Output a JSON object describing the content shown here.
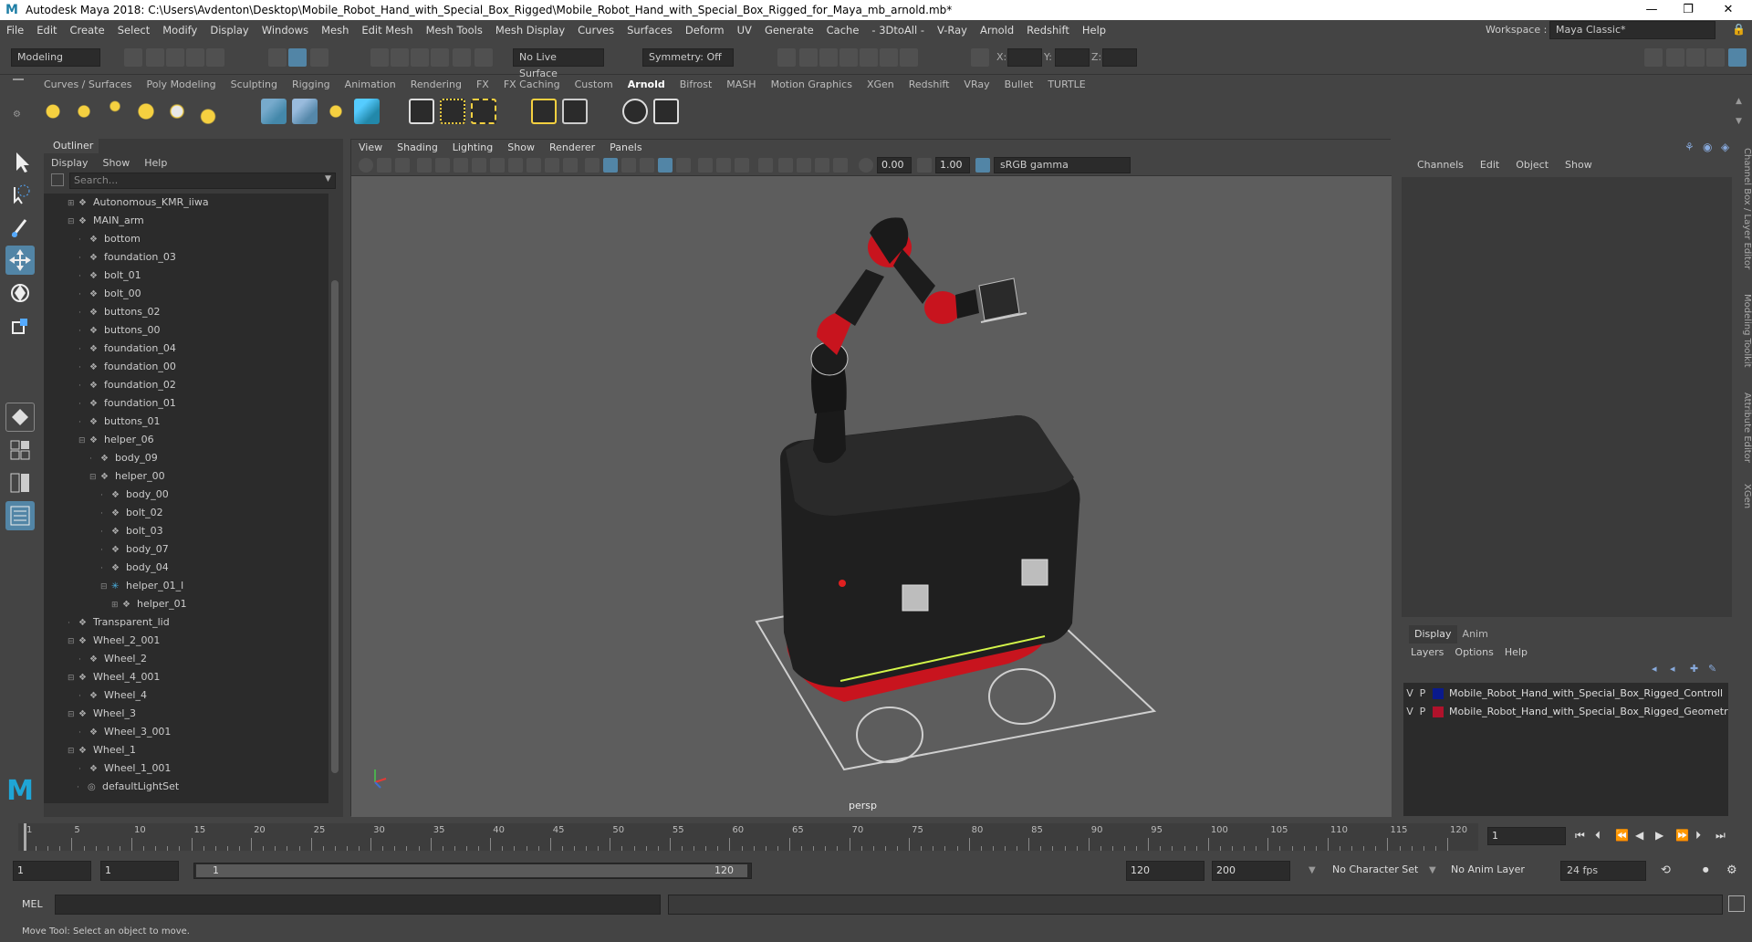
{
  "titlebar": {
    "title": "Autodesk Maya 2018: C:\\Users\\Avdenton\\Desktop\\Mobile_Robot_Hand_with_Special_Box_Rigged\\Mobile_Robot_Hand_with_Special_Box_Rigged_for_Maya_mb_arnold.mb*",
    "minimize": "—",
    "maximize": "❐",
    "close": "✕"
  },
  "menubar": [
    "File",
    "Edit",
    "Create",
    "Select",
    "Modify",
    "Display",
    "Windows",
    "Mesh",
    "Edit Mesh",
    "Mesh Tools",
    "Mesh Display",
    "Curves",
    "Surfaces",
    "Deform",
    "UV",
    "Generate",
    "Cache",
    "- 3DtoAll -",
    "V-Ray",
    "Arnold",
    "Redshift",
    "Help"
  ],
  "workspace": {
    "label": "Workspace :",
    "value": "Maya Classic*"
  },
  "statusline": {
    "mode": "Modeling",
    "live_surface": "No Live Surface",
    "symmetry": "Symmetry: Off",
    "x_label": "X:",
    "y_label": "Y:",
    "z_label": "Z:"
  },
  "shelf_tabs": [
    "Curves / Surfaces",
    "Poly Modeling",
    "Sculpting",
    "Rigging",
    "Animation",
    "Rendering",
    "FX",
    "FX Caching",
    "Custom",
    "Arnold",
    "Bifrost",
    "MASH",
    "Motion Graphics",
    "XGen",
    "Redshift",
    "VRay",
    "Bullet",
    "TURTLE"
  ],
  "active_shelf": "Arnold",
  "outliner": {
    "title": "Outliner",
    "menu": [
      "Display",
      "Show",
      "Help"
    ],
    "search_placeholder": "Search...",
    "items": [
      {
        "label": "Autonomous_KMR_iiwa",
        "depth": 0,
        "exp": "+"
      },
      {
        "label": "MAIN_arm",
        "depth": 0,
        "exp": "−"
      },
      {
        "label": "bottom",
        "depth": 1,
        "exp": ""
      },
      {
        "label": "foundation_03",
        "depth": 1,
        "exp": ""
      },
      {
        "label": "bolt_01",
        "depth": 1,
        "exp": ""
      },
      {
        "label": "bolt_00",
        "depth": 1,
        "exp": ""
      },
      {
        "label": "buttons_02",
        "depth": 1,
        "exp": ""
      },
      {
        "label": "buttons_00",
        "depth": 1,
        "exp": ""
      },
      {
        "label": "foundation_04",
        "depth": 1,
        "exp": ""
      },
      {
        "label": "foundation_00",
        "depth": 1,
        "exp": ""
      },
      {
        "label": "foundation_02",
        "depth": 1,
        "exp": ""
      },
      {
        "label": "foundation_01",
        "depth": 1,
        "exp": ""
      },
      {
        "label": "buttons_01",
        "depth": 1,
        "exp": ""
      },
      {
        "label": "helper_06",
        "depth": 1,
        "exp": "−"
      },
      {
        "label": "body_09",
        "depth": 2,
        "exp": ""
      },
      {
        "label": "helper_00",
        "depth": 2,
        "exp": "−"
      },
      {
        "label": "body_00",
        "depth": 3,
        "exp": ""
      },
      {
        "label": "bolt_02",
        "depth": 3,
        "exp": ""
      },
      {
        "label": "bolt_03",
        "depth": 3,
        "exp": ""
      },
      {
        "label": "body_07",
        "depth": 3,
        "exp": ""
      },
      {
        "label": "body_04",
        "depth": 3,
        "exp": ""
      },
      {
        "label": "helper_01_l",
        "depth": 3,
        "exp": "−",
        "icon": "joint"
      },
      {
        "label": "helper_01",
        "depth": 4,
        "exp": "+"
      },
      {
        "label": "Transparent_lid",
        "depth": 0,
        "exp": ""
      },
      {
        "label": "Wheel_2_001",
        "depth": 0,
        "exp": "−"
      },
      {
        "label": "Wheel_2",
        "depth": 1,
        "exp": ""
      },
      {
        "label": "Wheel_4_001",
        "depth": 0,
        "exp": "−"
      },
      {
        "label": "Wheel_4",
        "depth": 1,
        "exp": ""
      },
      {
        "label": "Wheel_3",
        "depth": 0,
        "exp": "−"
      },
      {
        "label": "Wheel_3_001",
        "depth": 1,
        "exp": ""
      },
      {
        "label": "Wheel_1",
        "depth": 0,
        "exp": "−"
      },
      {
        "label": "Wheel_1_001",
        "depth": 1,
        "exp": ""
      },
      {
        "label": "defaultLightSet",
        "depth": -1,
        "exp": "",
        "icon": "set"
      }
    ]
  },
  "viewport": {
    "menu": [
      "View",
      "Shading",
      "Lighting",
      "Show",
      "Renderer",
      "Panels"
    ],
    "value1": "0.00",
    "value2": "1.00",
    "color_space": "sRGB gamma",
    "camera": "persp"
  },
  "channel_box": {
    "menu": [
      "Channels",
      "Edit",
      "Object",
      "Show"
    ],
    "layer_tabs": [
      "Display",
      "Anim"
    ],
    "layer_menu": [
      "Layers",
      "Options",
      "Help"
    ],
    "layers": [
      {
        "v": "V",
        "p": "P",
        "color": "#0a1a8c",
        "name": "Mobile_Robot_Hand_with_Special_Box_Rigged_Controll"
      },
      {
        "v": "V",
        "p": "P",
        "color": "#b0122b",
        "name": "Mobile_Robot_Hand_with_Special_Box_Rigged_Geometr"
      }
    ]
  },
  "side_tabs": [
    "Channel Box / Layer Editor",
    "Modeling Toolkit",
    "Attribute Editor",
    "XGen"
  ],
  "timeline": {
    "ticks": [
      1,
      5,
      10,
      15,
      20,
      25,
      30,
      35,
      40,
      45,
      50,
      55,
      60,
      65,
      70,
      75,
      80,
      85,
      90,
      95,
      100,
      105,
      110,
      115,
      120
    ],
    "current_frame": "1"
  },
  "range": {
    "start": "1",
    "playback_start": "1",
    "slider_start": "1",
    "slider_end": "120",
    "playback_end": "120",
    "end": "200",
    "character_set": "No Character Set",
    "anim_layer": "No Anim Layer",
    "fps": "24 fps"
  },
  "mel": {
    "label": "MEL"
  },
  "help_line": "Move Tool: Select an object to move.",
  "colors": {
    "accent": "#5285a6",
    "robot_red": "#c8141e",
    "robot_body": "#1e1e1e",
    "highlight": "#d4f54a"
  }
}
